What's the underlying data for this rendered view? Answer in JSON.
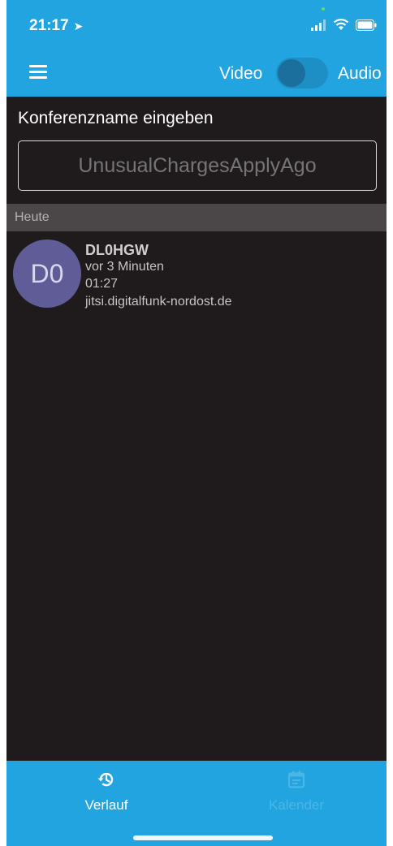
{
  "status_bar": {
    "time": "21:17",
    "icons": [
      "location-arrow-icon",
      "signal-icon",
      "wifi-icon",
      "battery-icon"
    ]
  },
  "app_bar": {
    "menu_icon": "hamburger-menu-icon",
    "toggle_left_label": "Video",
    "toggle_right_label": "Audio"
  },
  "conference": {
    "title": "Konferenzname eingeben",
    "input_placeholder": "UnusualChargesApplyAgo"
  },
  "history": {
    "section_label": "Heute",
    "items": [
      {
        "avatar_initials": "D0",
        "name": "DL0HGW",
        "time_ago": "vor 3 Minuten",
        "duration": "01:27",
        "server": "jitsi.digitalfunk-nordost.de"
      }
    ]
  },
  "bottom_tabs": [
    {
      "label": "Verlauf",
      "icon": "history-icon",
      "active": true
    },
    {
      "label": "Kalender",
      "icon": "calendar-icon",
      "active": false
    }
  ],
  "colors": {
    "accent": "#22a4e0",
    "background": "#1f1b1c",
    "avatar": "#5f5c97"
  }
}
